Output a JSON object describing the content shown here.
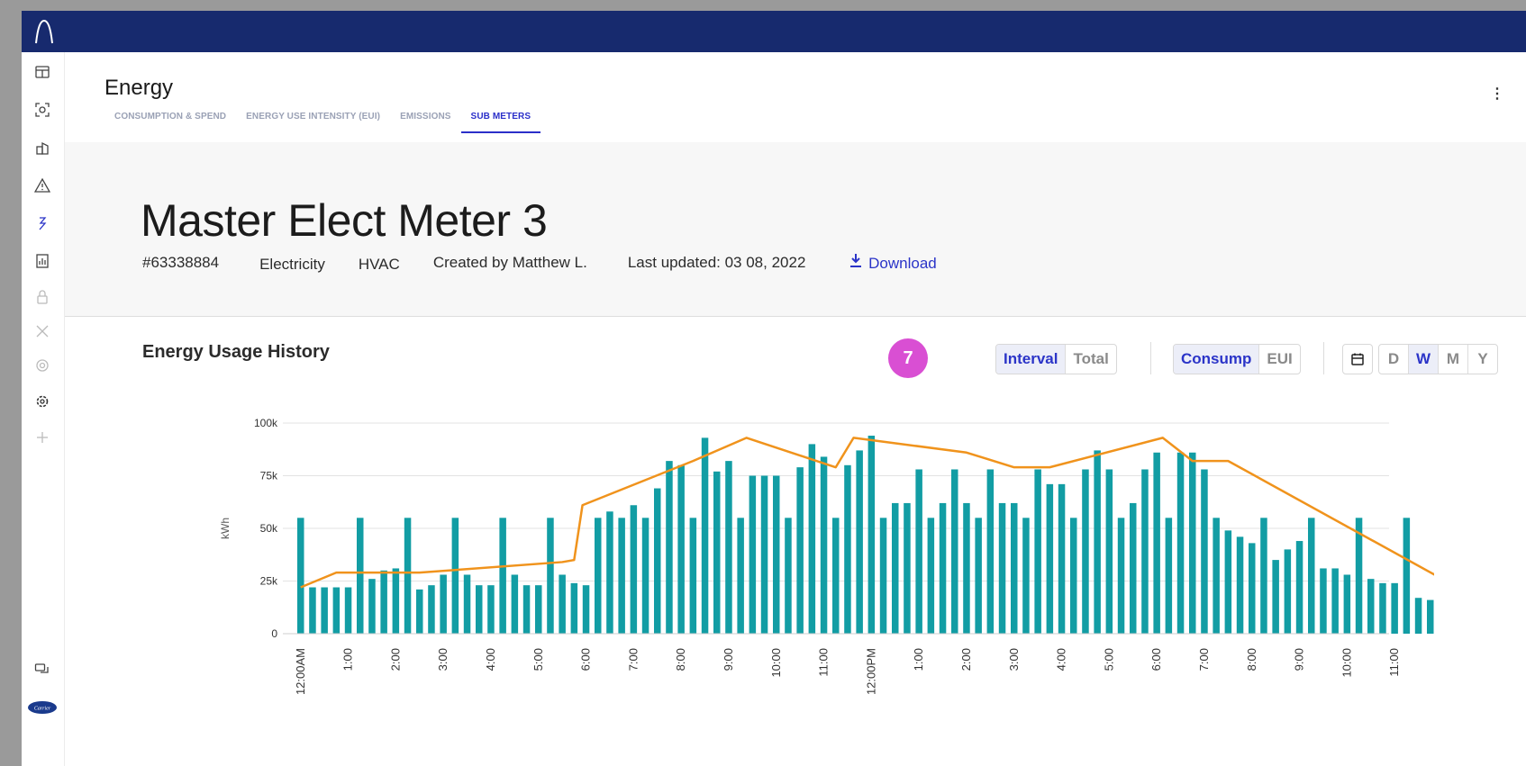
{
  "app": {
    "title": "Energy",
    "tabs": [
      {
        "label": "CONSUMPTION & SPEND",
        "active": false
      },
      {
        "label": "ENERGY USE INTENSITY (EUI)",
        "active": false
      },
      {
        "label": "EMISSIONS",
        "active": false
      },
      {
        "label": "SUB METERS",
        "active": true
      }
    ],
    "more_menu": "⋮"
  },
  "sidebar": {
    "icons": [
      "dashboard-icon",
      "scan-icon",
      "buildings-icon",
      "alert-icon",
      "energy-icon",
      "report-icon",
      "lock-icon",
      "tools-icon",
      "target-icon",
      "settings-icon",
      "add-icon",
      "chat-icon",
      "brand-logo-icon"
    ],
    "brand_logo_text": "Carrier"
  },
  "meter": {
    "name": "Master Elect Meter 3",
    "id": "#63338884",
    "type": "Electricity",
    "system": "HVAC",
    "created_by": "Created by Matthew L.",
    "last_updated": "Last updated: 03 08, 2022",
    "download_label": "Download"
  },
  "history": {
    "title": "Energy Usage History",
    "step_badge": "7",
    "mode_options": [
      "Interval",
      "Total"
    ],
    "mode_selected": "Interval",
    "metric_options": [
      "Consump",
      "EUI"
    ],
    "metric_selected": "Consump",
    "period_options": [
      "D",
      "W",
      "M",
      "Y"
    ],
    "period_selected": "W"
  },
  "colors": {
    "topbar": "#172a6e",
    "accent": "#2b34c8",
    "bar": "#129da4",
    "line": "#f0931c",
    "badge": "#d94fd3"
  },
  "chart_data": {
    "type": "bar",
    "ylabel": "kWh",
    "ylim": [
      0,
      100000
    ],
    "yticks": [
      "0",
      "25k",
      "50k",
      "75k",
      "100k"
    ],
    "xtick_labels": [
      "12:00AM",
      "1:00",
      "2:00",
      "3:00",
      "4:00",
      "5:00",
      "6:00",
      "7:00",
      "8:00",
      "9:00",
      "10:00",
      "11:00",
      "12:00PM",
      "1:00",
      "2:00",
      "3:00",
      "4:00",
      "5:00",
      "6:00",
      "7:00",
      "8:00",
      "9:00",
      "10:00",
      "11:00"
    ],
    "series": [
      {
        "kind": "bar",
        "values": [
          55000,
          22000,
          22000,
          22000,
          22000,
          55000,
          26000,
          30000,
          31000,
          55000,
          21000,
          23000,
          28000,
          55000,
          28000,
          23000,
          23000,
          55000,
          28000,
          23000,
          23000,
          55000,
          28000,
          24000,
          23000,
          55000,
          58000,
          55000,
          61000,
          55000,
          69000,
          82000,
          80000,
          55000,
          93000,
          77000,
          82000,
          55000,
          75000,
          75000,
          75000,
          55000,
          79000,
          90000,
          84000,
          55000,
          80000,
          87000,
          94000,
          55000,
          62000,
          62000,
          78000,
          55000,
          62000,
          78000,
          62000,
          55000,
          78000,
          62000,
          62000,
          55000,
          78000,
          71000,
          71000,
          55000,
          78000,
          87000,
          78000,
          55000,
          62000,
          78000,
          86000,
          55000,
          86000,
          86000,
          78000,
          55000,
          49000,
          46000,
          43000,
          55000,
          35000,
          40000,
          44000,
          55000,
          31000,
          31000,
          28000,
          55000,
          26000,
          24000,
          24000,
          55000,
          17000,
          16000,
          16000
        ]
      },
      {
        "kind": "line",
        "x": [
          0,
          3,
          10,
          22,
          23,
          23.7,
          33,
          37.5,
          45,
          46.5,
          56,
          60,
          63,
          72.5,
          75,
          78,
          96
        ],
        "values": [
          22000,
          29000,
          29000,
          34000,
          35000,
          61000,
          82000,
          93000,
          79000,
          93000,
          86000,
          79000,
          79000,
          93000,
          82000,
          82000,
          26000
        ]
      }
    ]
  }
}
